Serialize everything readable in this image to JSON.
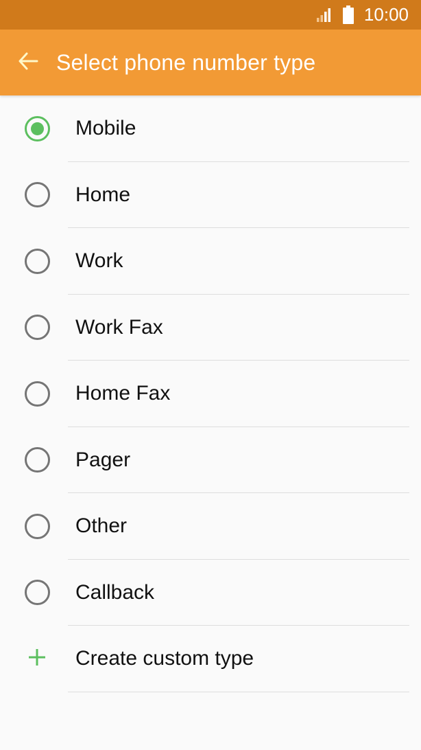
{
  "status_bar": {
    "time": "10:00",
    "signal_icon": "signal-icon",
    "battery_icon": "battery-icon"
  },
  "app_bar": {
    "title": "Select phone number type",
    "back_icon": "arrow-left-icon"
  },
  "options": [
    {
      "label": "Mobile",
      "selected": true
    },
    {
      "label": "Home",
      "selected": false
    },
    {
      "label": "Work",
      "selected": false
    },
    {
      "label": "Work Fax",
      "selected": false
    },
    {
      "label": "Home Fax",
      "selected": false
    },
    {
      "label": "Pager",
      "selected": false
    },
    {
      "label": "Other",
      "selected": false
    },
    {
      "label": "Callback",
      "selected": false
    }
  ],
  "custom": {
    "label": "Create custom type",
    "icon": "plus-icon"
  },
  "colors": {
    "status_bar": "#d07a1b",
    "app_bar": "#f29a35",
    "accent": "#5cbf5f",
    "background": "#fafafa"
  }
}
